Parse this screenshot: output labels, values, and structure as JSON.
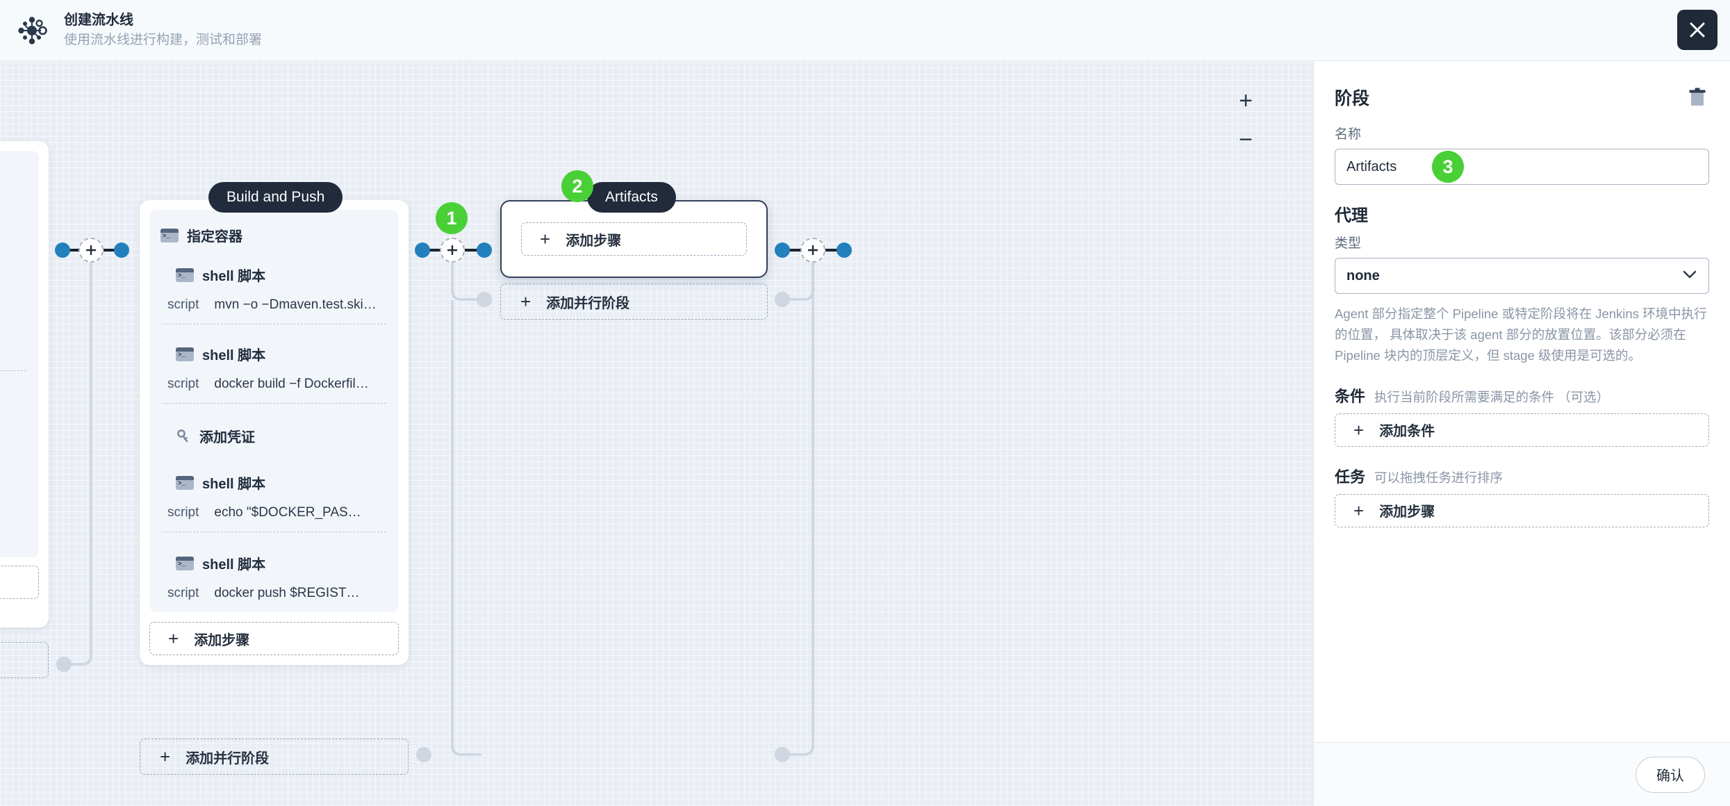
{
  "header": {
    "title": "创建流水线",
    "subtitle": "使用流水线进行构建，测试和部署",
    "logo_icon": "pipeline-node-logo",
    "close_icon": "close-icon"
  },
  "canvas": {
    "zoom_in_label": "+",
    "zoom_out_label": "−",
    "badges": [
      {
        "number": "1"
      },
      {
        "number": "2"
      },
      {
        "number": "3"
      }
    ],
    "stages": [
      {
        "id": "build-and-push",
        "pill_label": "Build and Push",
        "selected": false,
        "steps": [
          {
            "type": "header",
            "icon": "terminal-icon",
            "label": "指定容器",
            "indent": false
          },
          {
            "type": "header",
            "icon": "terminal-icon",
            "label": "shell 脚本",
            "indent": true
          },
          {
            "type": "script",
            "key": "script",
            "value": "mvn −o −Dmaven.test.ski…"
          },
          {
            "type": "header",
            "icon": "terminal-icon",
            "label": "shell 脚本",
            "indent": true
          },
          {
            "type": "script",
            "key": "script",
            "value": "docker build −f Dockerfil…"
          },
          {
            "type": "header",
            "icon": "key-icon",
            "label": "添加凭证",
            "indent": true
          },
          {
            "type": "header",
            "icon": "terminal-icon",
            "label": "shell 脚本",
            "indent": true
          },
          {
            "type": "script",
            "key": "script",
            "value": "echo \"$DOCKER_PAS…"
          },
          {
            "type": "header",
            "icon": "terminal-icon",
            "label": "shell 脚本",
            "indent": true
          },
          {
            "type": "script",
            "key": "script",
            "value": "docker push $REGIST…"
          }
        ],
        "add_step_label": "添加步骤",
        "add_parallel_label": "添加并行阶段"
      },
      {
        "id": "artifacts",
        "pill_label": "Artifacts",
        "selected": true,
        "steps": [],
        "add_step_label": "添加步骤",
        "add_parallel_label": "添加并行阶段"
      }
    ]
  },
  "panel": {
    "title": "阶段",
    "delete_icon": "trash-icon",
    "name_label": "名称",
    "name_value": "Artifacts",
    "agent_section_title": "代理",
    "type_label": "类型",
    "type_value": "none",
    "chevron_icon": "chevron-down-icon",
    "agent_help": "Agent 部分指定整个 Pipeline 或特定阶段将在 Jenkins 环境中执行的位置， 具体取决于该 agent 部分的放置位置。该部分必须在 Pipeline 块内的顶层定义，但 stage 级使用是可选的。",
    "condition_title": "条件",
    "condition_hint": "执行当前阶段所需要满足的条件 （可选）",
    "add_condition_label": "添加条件",
    "task_title": "任务",
    "task_hint": "可以拖拽任务进行排序",
    "add_step_label": "添加步骤",
    "confirm_label": "确认"
  },
  "colors": {
    "accent_green": "#49d037",
    "node_blue": "#2280bd",
    "dark_pill": "#212b3b",
    "canvas_bg": "#e9edf4"
  }
}
